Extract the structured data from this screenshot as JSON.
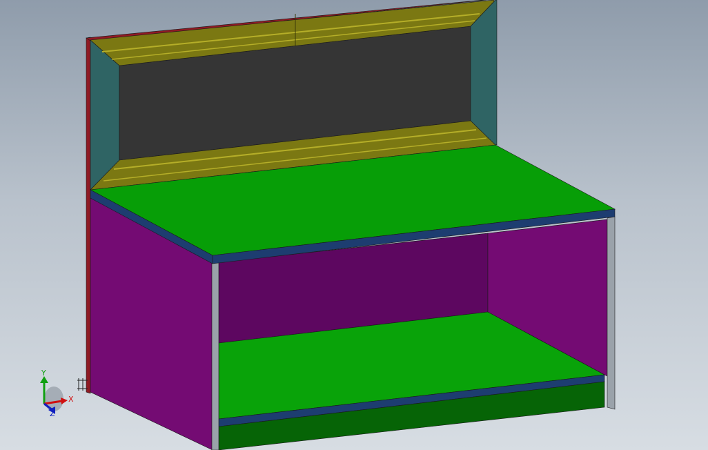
{
  "viewport": {
    "background_top": "#8f9cab",
    "background_bottom": "#d7dde3"
  },
  "model": {
    "colors": {
      "back_panel_edge": "#8f1a24",
      "backboard_display": "#353535",
      "side_cheek": "#2f6464",
      "crown_molding": "#7b7812",
      "crown_molding_highlight": "#b5ae28",
      "worktop": "#079e07",
      "worktop_edge_band": "#1d3d70",
      "cabinet_side": "#740b73",
      "cabinet_back_inner": "#5d0760",
      "leg_post": "#9aa2aa",
      "lower_shelf": "#09a309",
      "kick_plate": "#066406"
    }
  },
  "triad": {
    "x_label": "X",
    "y_label": "Y",
    "z_label": "Z",
    "x_color": "#d01010",
    "y_color": "#10a010",
    "z_color": "#1020c0"
  }
}
